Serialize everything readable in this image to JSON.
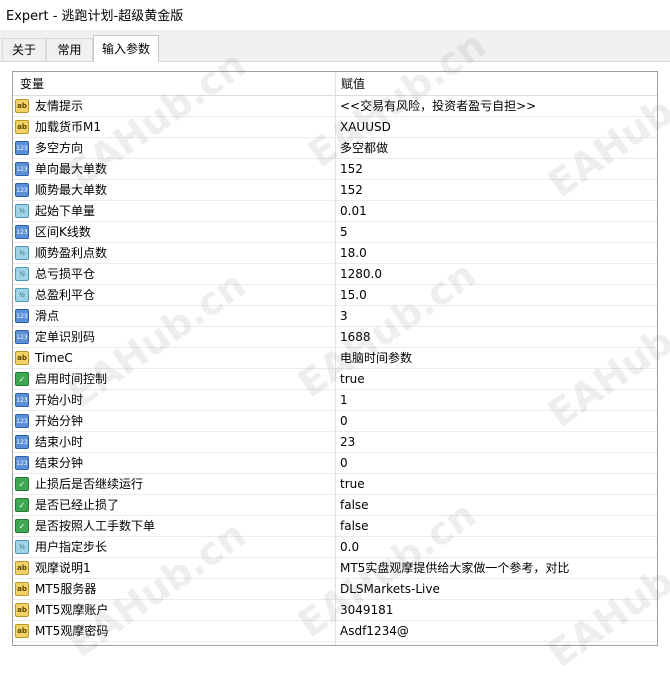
{
  "window": {
    "title": "Expert - 逃跑计划-超级黄金版"
  },
  "tabs": [
    {
      "label": "关于"
    },
    {
      "label": "常用"
    },
    {
      "label": "输入参数",
      "active": true
    }
  ],
  "grid": {
    "headers": {
      "variable": "变量",
      "value": "赋值"
    },
    "rows": [
      {
        "type": "ab",
        "icon_text": "ab",
        "name": "友情提示",
        "value": "<<交易有风险，投资者盈亏自担>>"
      },
      {
        "type": "ab",
        "icon_text": "ab",
        "name": "加载货币M1",
        "value": "XAUUSD"
      },
      {
        "type": "int",
        "icon_text": "123",
        "name": "多空方向",
        "value": "多空都做"
      },
      {
        "type": "int",
        "icon_text": "123",
        "name": "单向最大单数",
        "value": "152"
      },
      {
        "type": "int",
        "icon_text": "123",
        "name": "顺势最大单数",
        "value": "152"
      },
      {
        "type": "dbl",
        "icon_text": "½",
        "name": "起始下单量",
        "value": "0.01"
      },
      {
        "type": "int",
        "icon_text": "123",
        "name": "区间K线数",
        "value": "5"
      },
      {
        "type": "dbl",
        "icon_text": "½",
        "name": "顺势盈利点数",
        "value": "18.0"
      },
      {
        "type": "dbl",
        "icon_text": "½",
        "name": "总亏损平仓",
        "value": "1280.0"
      },
      {
        "type": "dbl",
        "icon_text": "½",
        "name": "总盈利平仓",
        "value": "15.0"
      },
      {
        "type": "int",
        "icon_text": "123",
        "name": "滑点",
        "value": "3"
      },
      {
        "type": "int",
        "icon_text": "123",
        "name": "定单识别码",
        "value": "1688"
      },
      {
        "type": "ab",
        "icon_text": "ab",
        "name": "TimeC",
        "value": "电脑时间参数"
      },
      {
        "type": "bool",
        "icon_text": "✓",
        "name": "启用时间控制",
        "value": "true"
      },
      {
        "type": "int",
        "icon_text": "123",
        "name": "开始小时",
        "value": "1"
      },
      {
        "type": "int",
        "icon_text": "123",
        "name": "开始分钟",
        "value": "0"
      },
      {
        "type": "int",
        "icon_text": "123",
        "name": "结束小时",
        "value": "23"
      },
      {
        "type": "int",
        "icon_text": "123",
        "name": "结束分钟",
        "value": "0"
      },
      {
        "type": "bool",
        "icon_text": "✓",
        "name": "止损后是否继续运行",
        "value": "true"
      },
      {
        "type": "bool",
        "icon_text": "✓",
        "name": "是否已经止损了",
        "value": "false"
      },
      {
        "type": "bool",
        "icon_text": "✓",
        "name": "是否按照人工手数下单",
        "value": "false"
      },
      {
        "type": "dbl",
        "icon_text": "½",
        "name": "用户指定步长",
        "value": "0.0"
      },
      {
        "type": "ab",
        "icon_text": "ab",
        "name": "观摩说明1",
        "value": "MT5实盘观摩提供给大家做一个参考，对比"
      },
      {
        "type": "ab",
        "icon_text": "ab",
        "name": "MT5服务器",
        "value": "DLSMarkets-Live"
      },
      {
        "type": "ab",
        "icon_text": "ab",
        "name": "MT5观摩账户",
        "value": "3049181"
      },
      {
        "type": "ab",
        "icon_text": "ab",
        "name": "MT5观摩密码",
        "value": "Asdf1234@"
      }
    ]
  },
  "watermark": {
    "text": "EAHub.cn"
  }
}
